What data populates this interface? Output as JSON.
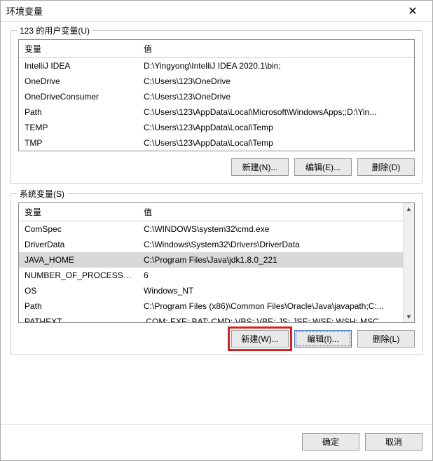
{
  "window": {
    "title": "环境变量"
  },
  "user_section": {
    "label": "123 的用户变量(U)",
    "col_name": "变量",
    "col_value": "值",
    "rows": [
      {
        "name": "IntelliJ IDEA",
        "value": "D:\\Yingyong\\IntelliJ IDEA 2020.1\\bin;"
      },
      {
        "name": "OneDrive",
        "value": "C:\\Users\\123\\OneDrive"
      },
      {
        "name": "OneDriveConsumer",
        "value": "C:\\Users\\123\\OneDrive"
      },
      {
        "name": "Path",
        "value": "C:\\Users\\123\\AppData\\Local\\Microsoft\\WindowsApps;;D:\\Yin..."
      },
      {
        "name": "TEMP",
        "value": "C:\\Users\\123\\AppData\\Local\\Temp"
      },
      {
        "name": "TMP",
        "value": "C:\\Users\\123\\AppData\\Local\\Temp"
      }
    ],
    "btn_new": "新建(N)...",
    "btn_edit": "编辑(E)...",
    "btn_delete": "删除(D)"
  },
  "system_section": {
    "label": "系统变量(S)",
    "col_name": "变量",
    "col_value": "值",
    "rows": [
      {
        "name": "ComSpec",
        "value": "C:\\WINDOWS\\system32\\cmd.exe"
      },
      {
        "name": "DriverData",
        "value": "C:\\Windows\\System32\\Drivers\\DriverData"
      },
      {
        "name": "JAVA_HOME",
        "value": "C:\\Program Files\\Java\\jdk1.8.0_221",
        "selected": true
      },
      {
        "name": "NUMBER_OF_PROCESSORS",
        "value": "6"
      },
      {
        "name": "OS",
        "value": "Windows_NT"
      },
      {
        "name": "Path",
        "value": "C:\\Program Files (x86)\\Common Files\\Oracle\\Java\\javapath;C:..."
      },
      {
        "name": "PATHEXT",
        "value": ".COM;.EXE;.BAT;.CMD;.VBS;.VBE;.JS;.JSE;.WSF;.WSH;.MSC"
      }
    ],
    "btn_new": "新建(W)...",
    "btn_edit": "编辑(I)...",
    "btn_delete": "删除(L)"
  },
  "footer": {
    "ok": "确定",
    "cancel": "取消"
  }
}
